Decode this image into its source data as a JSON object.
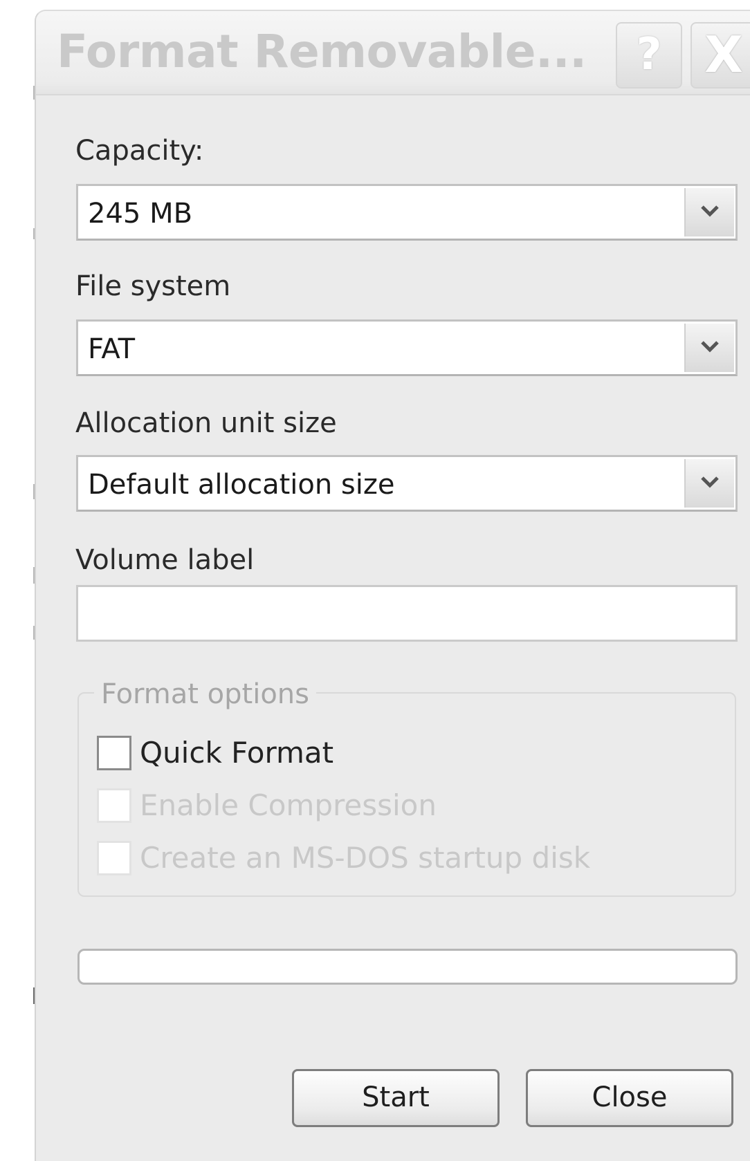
{
  "window": {
    "title": "Format Removable...",
    "help_button": "?",
    "close_button": "X"
  },
  "capacity": {
    "label": "Capacity:",
    "selected": "245 MB"
  },
  "file_system": {
    "label": "File system",
    "selected": "FAT"
  },
  "allocation_unit_size": {
    "label": "Allocation unit size",
    "selected": "Default allocation size"
  },
  "volume_label": {
    "label": "Volume label",
    "value": ""
  },
  "format_options": {
    "title": "Format options",
    "options": [
      {
        "label": "Quick Format",
        "checked": false,
        "enabled": true
      },
      {
        "label": "Enable Compression",
        "checked": false,
        "enabled": false
      },
      {
        "label": "Create an MS-DOS startup disk",
        "checked": false,
        "enabled": false
      }
    ]
  },
  "progress": {
    "value": 0
  },
  "buttons": {
    "start_label": "Start",
    "close_label": "Close"
  },
  "icons": {
    "dropdown": "chevron-down-icon",
    "help": "help-icon",
    "close": "close-icon"
  }
}
